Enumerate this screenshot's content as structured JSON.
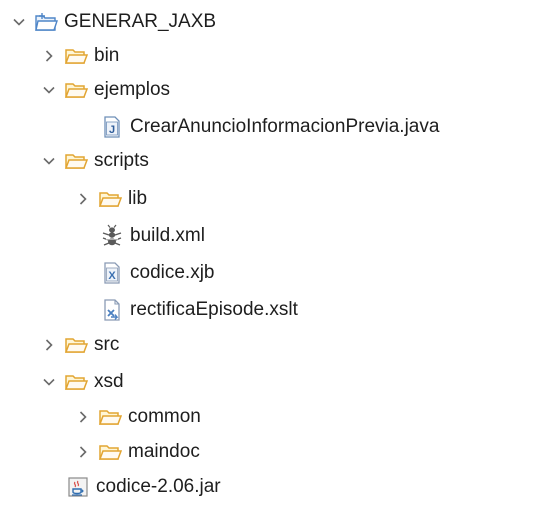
{
  "colors": {
    "folder_stroke": "#e2a532",
    "folder_fill": "#fff6d6",
    "project_stroke": "#4f86c8",
    "twisty": "#6a6a6a",
    "java": "#2f5d9a",
    "xjb": "#3a6fb0",
    "xslt": "#4a7fc0"
  },
  "tree": {
    "root": {
      "label": "GENERAR_JAXB",
      "icon": "project-folder-icon",
      "expanded": true
    },
    "bin": {
      "label": "bin",
      "icon": "folder-icon",
      "expanded": false
    },
    "ejemplos": {
      "label": "ejemplos",
      "icon": "folder-icon",
      "expanded": true
    },
    "java_file": {
      "label": "CrearAnuncioInformacionPrevia.java",
      "icon": "java-file-icon"
    },
    "scripts": {
      "label": "scripts",
      "icon": "folder-icon",
      "expanded": true
    },
    "lib": {
      "label": "lib",
      "icon": "folder-icon",
      "expanded": false
    },
    "build": {
      "label": "build.xml",
      "icon": "ant-build-icon"
    },
    "xjb": {
      "label": "codice.xjb",
      "icon": "xjb-file-icon"
    },
    "xslt": {
      "label": "rectificaEpisode.xslt",
      "icon": "xslt-file-icon"
    },
    "src": {
      "label": "src",
      "icon": "folder-icon",
      "expanded": false
    },
    "xsd": {
      "label": "xsd",
      "icon": "folder-icon",
      "expanded": true
    },
    "common": {
      "label": "common",
      "icon": "folder-icon",
      "expanded": false
    },
    "maindoc": {
      "label": "maindoc",
      "icon": "folder-icon",
      "expanded": false
    },
    "jar": {
      "label": "codice-2.06.jar",
      "icon": "jar-file-icon"
    }
  }
}
